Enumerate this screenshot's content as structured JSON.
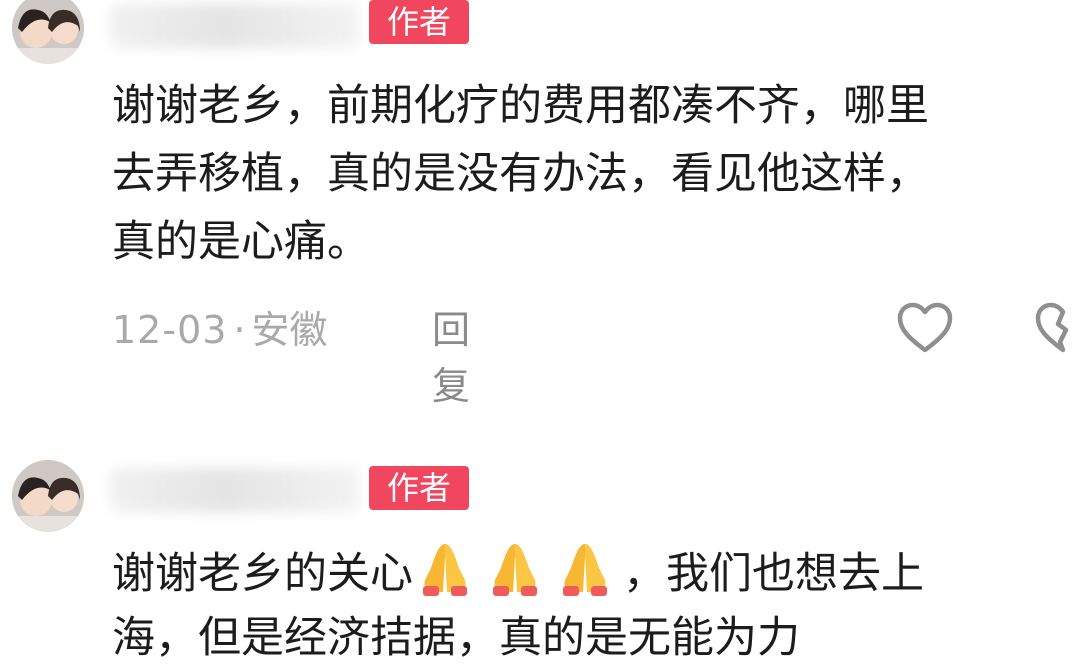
{
  "comments": [
    {
      "author_badge": "作者",
      "lines": [
        "谢谢老乡，前期化疗的费用都凑不齐，哪里",
        "去弄移植，真的是没有办法，看见他这样，",
        "真的是心痛。"
      ],
      "date": "12-03",
      "separator": "·",
      "location": "安徽",
      "reply_label": "回复",
      "icons": [
        "heart-outline-icon",
        "broken-heart-outline-icon"
      ]
    },
    {
      "author_badge": "作者",
      "text_before_emoji": "谢谢老乡的关心",
      "emoji": [
        "folded-hands-emoji",
        "folded-hands-emoji",
        "folded-hands-emoji"
      ],
      "text_after_emoji": "，我们也想去上",
      "line2": "海，但是经济拮据，真的是无能为力"
    }
  ],
  "colors": {
    "badge": "#f0475f",
    "text": "#1c1c1c",
    "meta": "#a9a9a9"
  }
}
